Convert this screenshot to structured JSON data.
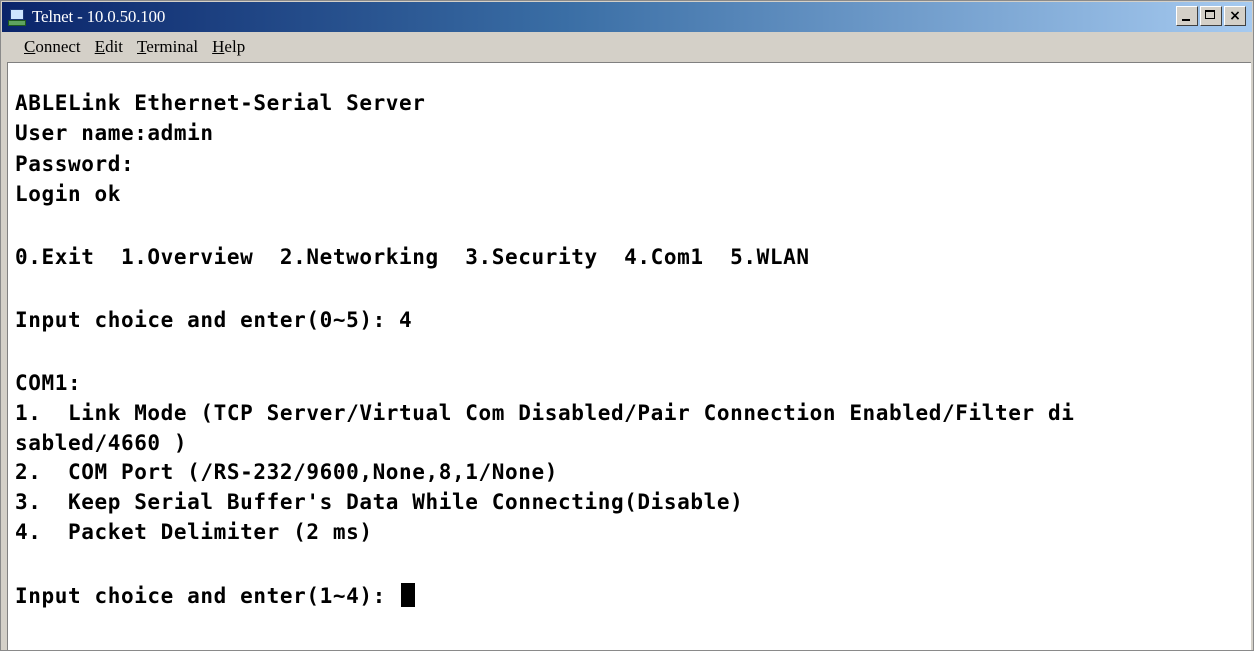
{
  "window": {
    "title": "Telnet - 10.0.50.100",
    "title_bar_color": "#0a246a"
  },
  "title_buttons": {
    "minimize": "minimize-icon",
    "maximize": "maximize-icon",
    "close": "×"
  },
  "menu": {
    "connect": {
      "accel": "C",
      "rest": "onnect"
    },
    "edit": {
      "accel": "E",
      "rest": "dit"
    },
    "terminal": {
      "accel": "T",
      "rest": "erminal"
    },
    "help": {
      "accel": "H",
      "rest": "elp"
    }
  },
  "terminal": {
    "lines": [
      "ABLELink Ethernet-Serial Server",
      "User name:admin",
      "Password:",
      "Login ok",
      "",
      "0.Exit  1.Overview  2.Networking  3.Security  4.Com1  5.WLAN",
      "",
      "Input choice and enter(0~5): 4",
      "",
      "COM1:",
      "1.  Link Mode (TCP Server/Virtual Com Disabled/Pair Connection Enabled/Filter di",
      "sabled/4660 )",
      "2.  COM Port (/RS-232/9600,None,8,1/None)",
      "3.  Keep Serial Buffer's Data While Connecting(Disable)",
      "4.  Packet Delimiter (2 ms)",
      "",
      "Input choice and enter(1~4): "
    ]
  }
}
